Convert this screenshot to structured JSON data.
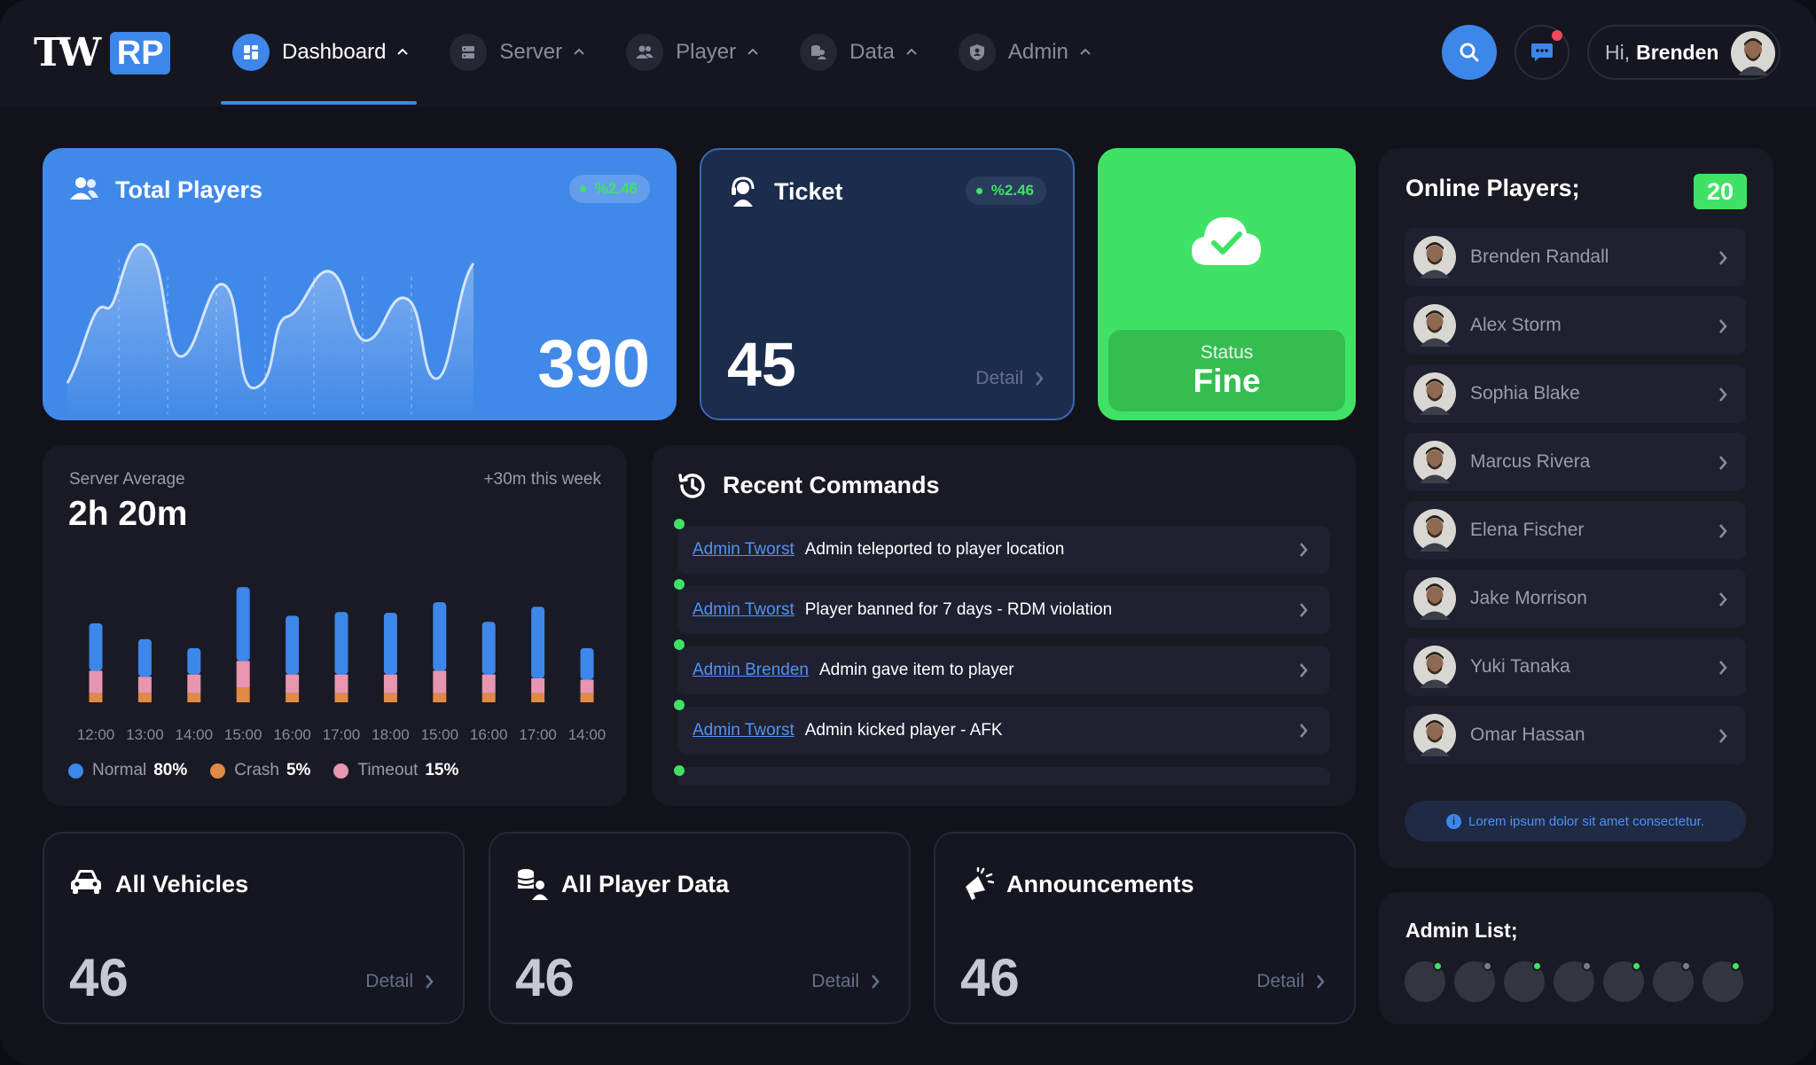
{
  "brand": {
    "logo_tw": "TW",
    "logo_rp": "RP"
  },
  "nav": {
    "items": [
      {
        "label": "Dashboard",
        "icon": "dashboard-icon",
        "active": true
      },
      {
        "label": "Server",
        "icon": "server-icon",
        "active": false
      },
      {
        "label": "Player",
        "icon": "player-icon",
        "active": false
      },
      {
        "label": "Data",
        "icon": "data-icon",
        "active": false
      },
      {
        "label": "Admin",
        "icon": "admin-shield-icon",
        "active": false
      }
    ]
  },
  "header": {
    "greeting": "Hi,",
    "user_name": "Brenden",
    "chat_unread": true
  },
  "total_players": {
    "title": "Total Players",
    "badge": "%2.46",
    "value": "390"
  },
  "ticket": {
    "title": "Ticket",
    "badge": "%2.46",
    "value": "45",
    "detail": "Detail"
  },
  "status": {
    "label": "Status",
    "value": "Fine"
  },
  "server_average": {
    "label": "Server Average",
    "value": "2h 20m",
    "week_change": "+30m this week",
    "legend": [
      {
        "name": "Normal",
        "pct": "80%",
        "color": "#3d86ea"
      },
      {
        "name": "Crash",
        "pct": "5%",
        "color": "#e08a45"
      },
      {
        "name": "Timeout",
        "pct": "15%",
        "color": "#e895b0"
      }
    ]
  },
  "chart_data": {
    "type": "bar",
    "categories": [
      "12:00",
      "13:00",
      "14:00",
      "15:00",
      "16:00",
      "17:00",
      "18:00",
      "15:00",
      "16:00",
      "17:00",
      "14:00"
    ],
    "series": [
      {
        "name": "Crash",
        "values": [
          12,
          12,
          12,
          20,
          12,
          12,
          12,
          12,
          12,
          12,
          12
        ]
      },
      {
        "name": "Timeout",
        "values": [
          30,
          22,
          25,
          35,
          25,
          25,
          25,
          30,
          25,
          20,
          18
        ]
      },
      {
        "name": "Normal",
        "values": [
          63,
          50,
          35,
          98,
          78,
          83,
          82,
          91,
          70,
          95,
          42
        ]
      }
    ],
    "stacked": true,
    "colors": [
      "#e08a45",
      "#e895b0",
      "#3d86ea"
    ],
    "grid": false
  },
  "recent_commands": {
    "title": "Recent Commands",
    "items": [
      {
        "admin": "Admin Tworst",
        "message": "Admin teleported to player location"
      },
      {
        "admin": "Admin Tworst",
        "message": "Player banned for 7 days - RDM violation"
      },
      {
        "admin": "Admin Brenden",
        "message": "Admin gave item to player"
      },
      {
        "admin": "Admin Tworst",
        "message": "Admin kicked player - AFK"
      }
    ]
  },
  "bottom_cards": [
    {
      "title": "All Vehicles",
      "value": "46",
      "detail": "Detail",
      "icon": "car-icon"
    },
    {
      "title": "All Player Data",
      "value": "46",
      "detail": "Detail",
      "icon": "player-data-icon"
    },
    {
      "title": "Announcements",
      "value": "46",
      "detail": "Detail",
      "icon": "megaphone-icon"
    }
  ],
  "online_players": {
    "title": "Online Players;",
    "count": "20",
    "players": [
      "Brenden Randall",
      "Alex Storm",
      "Sophia Blake",
      "Marcus Rivera",
      "Elena Fischer",
      "Jake Morrison",
      "Yuki Tanaka",
      "Omar Hassan"
    ],
    "info": "Lorem ipsum dolor sit amet consectetur."
  },
  "admin_list": {
    "title": "Admin List;",
    "admins": [
      {
        "online": true
      },
      {
        "online": false
      },
      {
        "online": true
      },
      {
        "online": false
      },
      {
        "online": true
      },
      {
        "online": false
      },
      {
        "online": true
      }
    ],
    "online_color": "#3fe265",
    "offline_color": "#7a7c88"
  }
}
